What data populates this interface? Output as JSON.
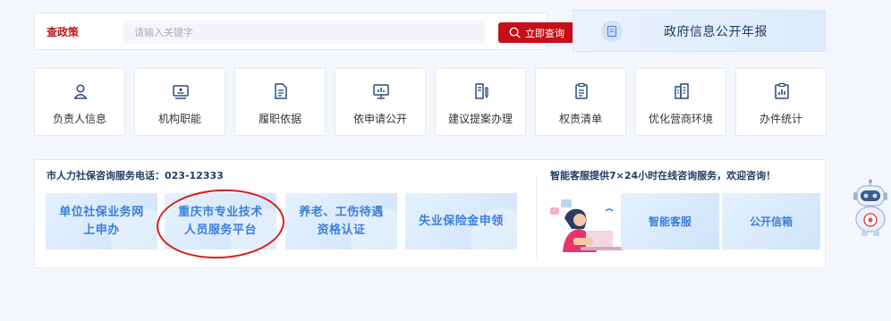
{
  "search": {
    "label": "查政策",
    "placeholder": "请输入关键字",
    "button_label": "立即查询"
  },
  "annual_report": {
    "label": "政府信息公开年报",
    "icon": "report-book-icon"
  },
  "quick_links": [
    {
      "label": "负责人信息",
      "icon": "person-icon"
    },
    {
      "label": "机构职能",
      "icon": "id-card-icon"
    },
    {
      "label": "履职依据",
      "icon": "document-icon"
    },
    {
      "label": "依申请公开",
      "icon": "monitor-chart-icon"
    },
    {
      "label": "建议提案办理",
      "icon": "doc-pen-icon"
    },
    {
      "label": "权责清单",
      "icon": "clipboard-list-icon"
    },
    {
      "label": "优化营商环境",
      "icon": "building-icon"
    },
    {
      "label": "办件统计",
      "icon": "stats-board-icon"
    }
  ],
  "services": {
    "hotline_text": "市人力社保咨询服务电话：023-12333",
    "online_text": "智能客服提供7×24小时在线咨询服务，欢迎咨询！",
    "tiles": [
      {
        "line1": "单位社保业务网",
        "line2": "上申办"
      },
      {
        "line1": "重庆市专业技术",
        "line2": "人员服务平台"
      },
      {
        "line1": "养老、工伤待遇",
        "line2": "资格认证"
      },
      {
        "line1": "失业保险金申领",
        "line2": ""
      }
    ],
    "smart_service": "智能客服",
    "mailbox": "公开信箱"
  },
  "colors": {
    "accent_red": "#c70f19",
    "tile_text": "#3c7fd8",
    "background": "#f3f6fa"
  }
}
